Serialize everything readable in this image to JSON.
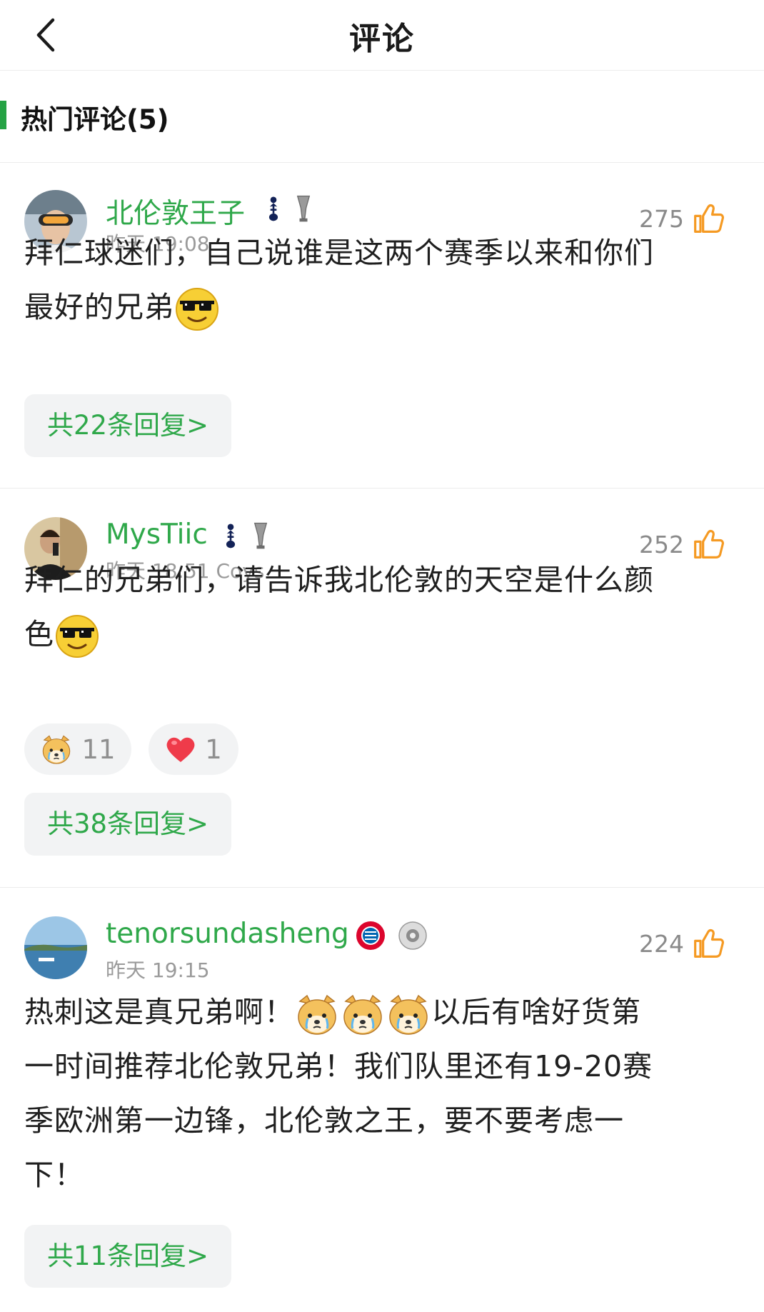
{
  "header": {
    "title": "评论",
    "back_icon": "chevron-left-icon"
  },
  "section": {
    "title": "热门评论(5)",
    "accent": "#25a244"
  },
  "colors": {
    "username": "#2fa84a",
    "like_icon": "#f59a23",
    "reply_bg": "#f2f3f4"
  },
  "comments": [
    {
      "username": "北伦敦王子",
      "time": "昨天 19:08",
      "likes": "275",
      "text_line1": "拜仁球迷们，自己说谁是这两个赛季以来和你们",
      "text_line2": "最好的兄弟",
      "reply_label": "共22条回复>"
    },
    {
      "username": "MysTiic",
      "time": "昨天 18:51 Coys",
      "likes": "252",
      "text_line1": "拜仁的兄弟们，请告诉我北伦敦的天空是什么颜",
      "text_line2": "色",
      "reactions": [
        {
          "icon": "crying-dog-emoji-icon",
          "count": "11"
        },
        {
          "icon": "heart-icon",
          "count": "1"
        }
      ],
      "reply_label": "共38条回复>"
    },
    {
      "username": "tenorsundasheng",
      "time": "昨天 19:15",
      "likes": "224",
      "text_part1": "热刺这是真兄弟啊！",
      "text_part2": "以后有啥好货第",
      "text_line2": "一时间推荐北伦敦兄弟！我们队里还有19-20赛",
      "text_line3": "季欧洲第一边锋，北伦敦之王，要不要考虑一",
      "text_line4": "下！",
      "reply_label": "共11条回复>"
    }
  ]
}
